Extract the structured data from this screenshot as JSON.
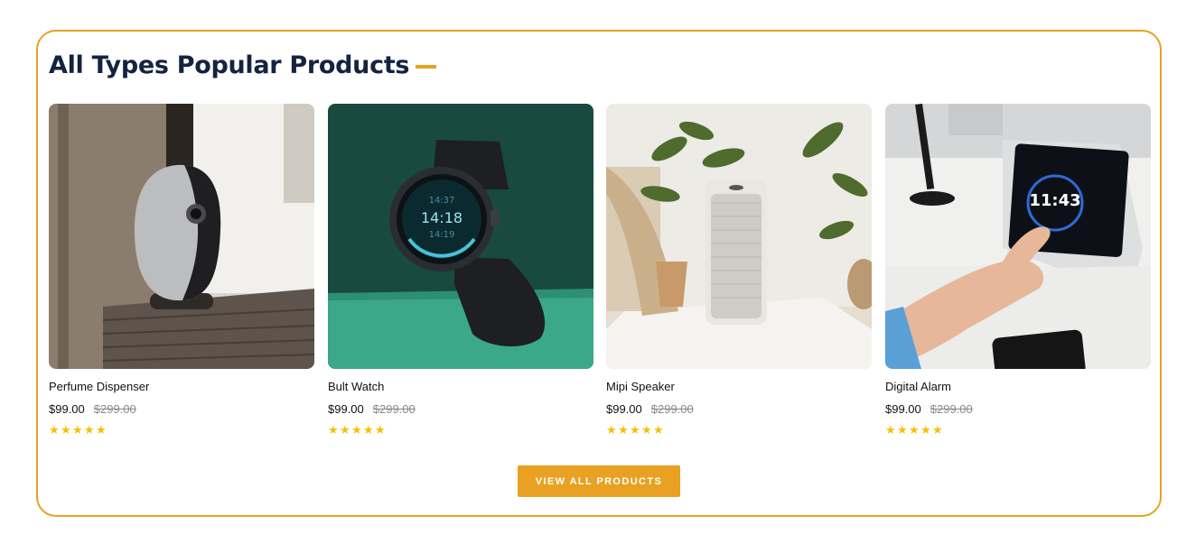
{
  "section": {
    "title": "All Types Popular Products"
  },
  "products": [
    {
      "name": "Perfume Dispenser",
      "price": "$99.00",
      "old_price": "$299.00",
      "rating": 5,
      "image": "security-camera-on-shelf"
    },
    {
      "name": "Bult Watch",
      "price": "$99.00",
      "old_price": "$299.00",
      "rating": 5,
      "image": "smartwatch-on-green-background",
      "watch_time": "14:18",
      "watch_time_top": "14:37",
      "watch_time_bottom": "14:19"
    },
    {
      "name": "Mipi Speaker",
      "price": "$99.00",
      "old_price": "$299.00",
      "rating": 5,
      "image": "speaker-in-living-room"
    },
    {
      "name": "Digital Alarm",
      "price": "$99.00",
      "old_price": "$299.00",
      "rating": 5,
      "image": "smart-display-clock",
      "display_time": "11:43"
    }
  ],
  "cta": {
    "label": "VIEW ALL PRODUCTS"
  },
  "colors": {
    "accent": "#e8a122",
    "heading": "#14233f",
    "star": "#f6c000"
  }
}
